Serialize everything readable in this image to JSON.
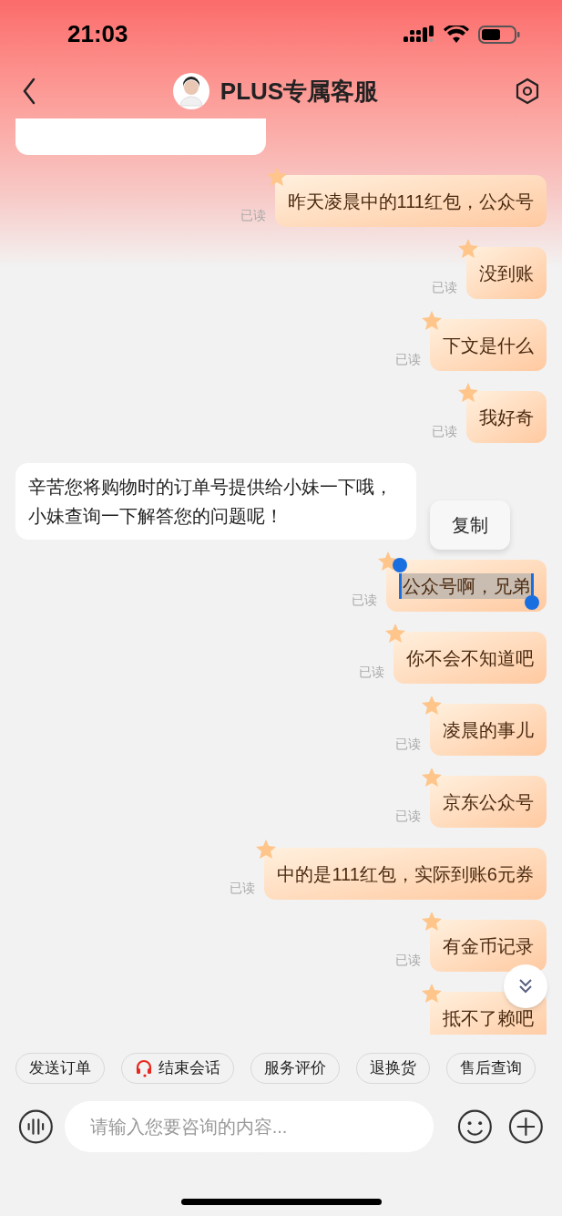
{
  "status_bar": {
    "time": "21:03"
  },
  "header": {
    "title": "PLUS专属客服"
  },
  "messages": [
    {
      "kind": "user",
      "text": "昨天凌晨中的111红包，公众号",
      "status": "已读"
    },
    {
      "kind": "user",
      "text": "没到账",
      "status": "已读"
    },
    {
      "kind": "user",
      "text": "下文是什么",
      "status": "已读"
    },
    {
      "kind": "user",
      "text": "我好奇",
      "status": "已读"
    },
    {
      "kind": "agent",
      "text": "辛苦您将购物时的订单号提供给小妹一下哦，小妹查询一下解答您的问题呢！"
    },
    {
      "kind": "user",
      "text": "公众号啊，兄弟",
      "status": "已读",
      "selected": true
    },
    {
      "kind": "user",
      "text": "你不会不知道吧",
      "status": "已读"
    },
    {
      "kind": "user",
      "text": "凌晨的事儿",
      "status": "已读"
    },
    {
      "kind": "user",
      "text": "京东公众号",
      "status": "已读"
    },
    {
      "kind": "user",
      "text": "中的是111红包，实际到账6元券",
      "status": "已读"
    },
    {
      "kind": "user",
      "text": "有金币记录",
      "status": "已读"
    },
    {
      "kind": "user",
      "text": "抵不了赖吧"
    }
  ],
  "context_menu": {
    "items": [
      "复制"
    ]
  },
  "quick_actions": [
    {
      "kind": "plain",
      "label": "发送订单"
    },
    {
      "kind": "icon",
      "label": "结束会话"
    },
    {
      "kind": "plain",
      "label": "服务评价"
    },
    {
      "kind": "plain",
      "label": "退换货"
    },
    {
      "kind": "plain",
      "label": "售后查询"
    }
  ],
  "composer": {
    "placeholder": "请输入您要咨询的内容..."
  }
}
